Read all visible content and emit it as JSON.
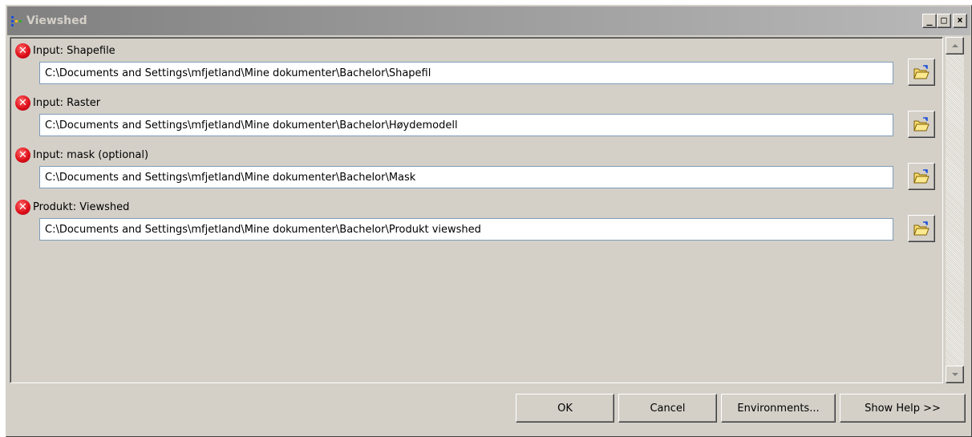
{
  "window": {
    "title": "Viewshed",
    "controls": {
      "minimize": "_",
      "maximize": "□",
      "close": "×"
    }
  },
  "parameters": [
    {
      "label": "Input: Shapefile",
      "value": "C:\\Documents and Settings\\mfjetland\\Mine dokumenter\\Bachelor\\Shapefil",
      "status_icon": "error-icon"
    },
    {
      "label": "Input: Raster",
      "value": "C:\\Documents and Settings\\mfjetland\\Mine dokumenter\\Bachelor\\Høydemodell",
      "status_icon": "error-icon"
    },
    {
      "label": "Input: mask (optional)",
      "value": "C:\\Documents and Settings\\mfjetland\\Mine dokumenter\\Bachelor\\Mask",
      "status_icon": "error-icon"
    },
    {
      "label": "Produkt: Viewshed",
      "value": "C:\\Documents and Settings\\mfjetland\\Mine dokumenter\\Bachelor\\Produkt viewshed",
      "status_icon": "error-icon"
    }
  ],
  "footer": {
    "ok": "OK",
    "cancel": "Cancel",
    "environments": "Environments...",
    "help": "Show Help >>"
  },
  "colors": {
    "title_gradient_start": "#808080",
    "title_gradient_end": "#b9b9b9",
    "error_red": "#e0101a",
    "window_face": "#d4d0c8"
  }
}
